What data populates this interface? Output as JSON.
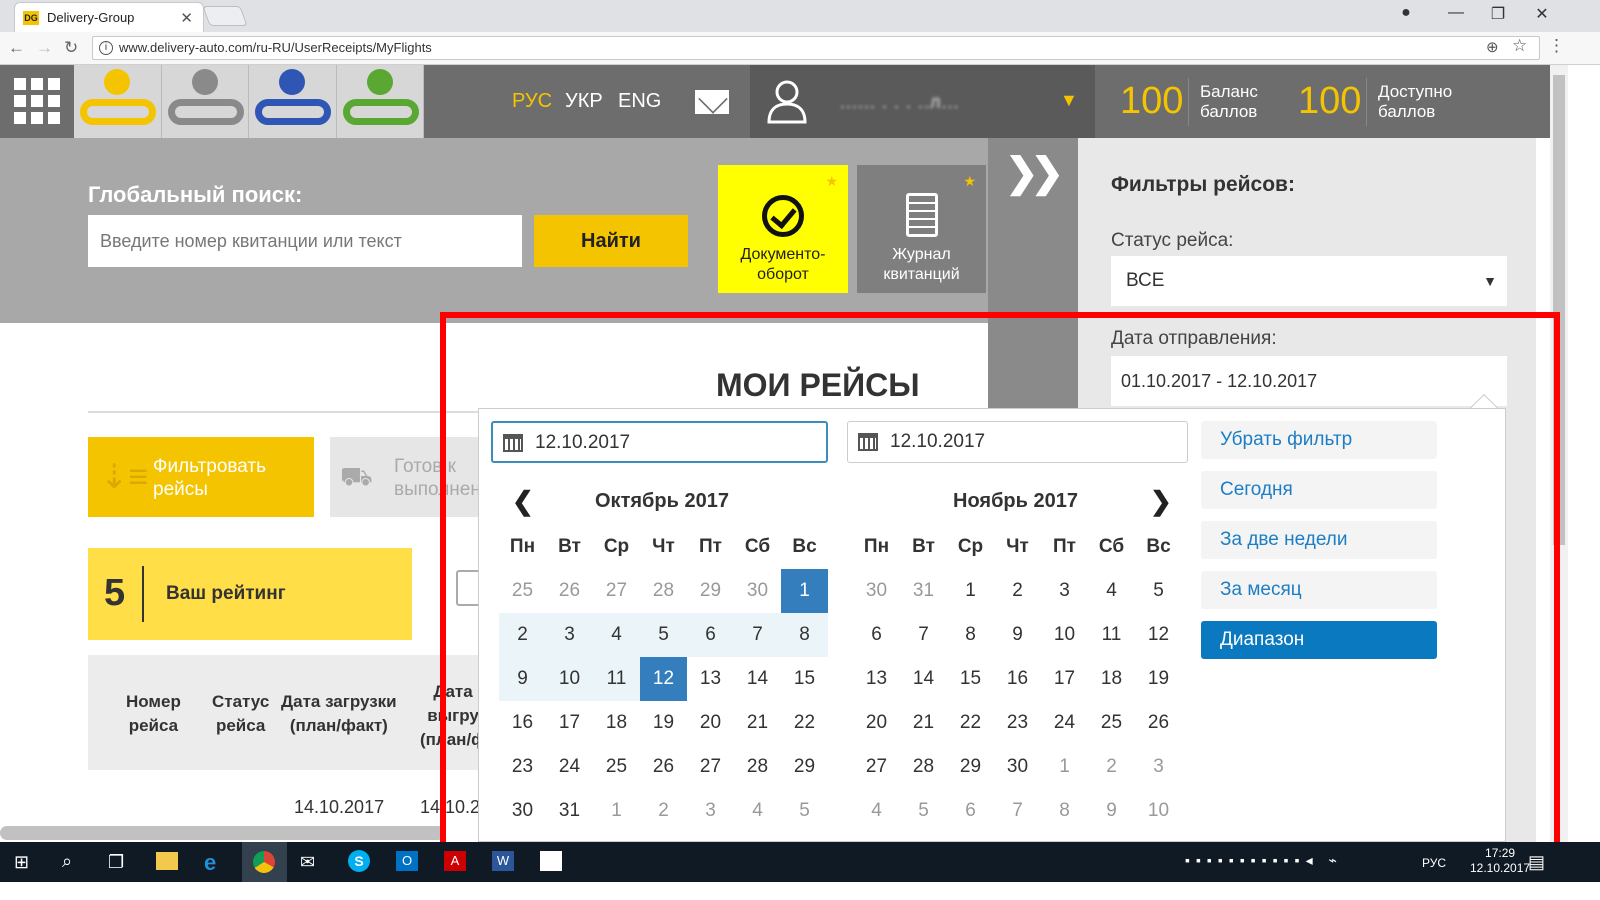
{
  "browser": {
    "tab_title": "Delivery-Group",
    "favicon_text": "DG",
    "url": "www.delivery-auto.com/ru-RU/UserReceipts/MyFlights"
  },
  "header": {
    "languages": [
      "РУС",
      "УКР",
      "ENG"
    ],
    "user_name": "...... . . . ..л...",
    "balance_value": "100",
    "balance_label_1": "Баланс",
    "balance_label_2": "баллов",
    "available_value": "100",
    "available_label_1": "Доступно",
    "available_label_2": "баллов",
    "logo_colors": [
      "#f5c400",
      "#8a8a8a",
      "#2f55b5",
      "#5aa832"
    ]
  },
  "search": {
    "label": "Глобальный поиск:",
    "placeholder": "Введите номер квитанции или текст",
    "button": "Найти"
  },
  "tiles": {
    "documents_line1": "Документо-",
    "documents_line2": "оборот",
    "journal_line1": "Журнал",
    "journal_line2": "квитанций"
  },
  "filters": {
    "title": "Фильтры рейсов:",
    "status_label": "Статус рейса:",
    "status_value": "ВСЕ",
    "date_label": "Дата отправления:",
    "date_value": "01.10.2017 - 12.10.2017"
  },
  "main": {
    "title": "МОИ РЕЙСЫ",
    "filter_button_line1": "Фильтровать",
    "filter_button_line2": "рейсы",
    "ready_button_line1": "Готов к",
    "ready_button_line2": "выполнен",
    "rating_value": "5",
    "rating_label": "Ваш рейтинг",
    "columns": [
      [
        "Номер",
        "рейса"
      ],
      [
        "Статус",
        "рейса"
      ],
      [
        "Дата загрузки",
        "(план/факт)"
      ],
      [
        "Дата",
        "выгру",
        "(план/ф"
      ]
    ],
    "row1_load_date": "14.10.2017",
    "row1_unload_date": "14.10.2"
  },
  "datepicker": {
    "start_date": "12.10.2017",
    "end_date": "12.10.2017",
    "options": [
      "Убрать фильтр",
      "Сегодня",
      "За две недели",
      "За месяц",
      "Диапазон"
    ],
    "active_option": "Диапазон",
    "weekdays": [
      "Пн",
      "Вт",
      "Ср",
      "Чт",
      "Пт",
      "Сб",
      "Вс"
    ],
    "left_month": {
      "title": "Октябрь 2017",
      "days": [
        [
          "25",
          "26",
          "27",
          "28",
          "29",
          "30",
          "1"
        ],
        [
          "2",
          "3",
          "4",
          "5",
          "6",
          "7",
          "8"
        ],
        [
          "9",
          "10",
          "11",
          "12",
          "13",
          "14",
          "15"
        ],
        [
          "16",
          "17",
          "18",
          "19",
          "20",
          "21",
          "22"
        ],
        [
          "23",
          "24",
          "25",
          "26",
          "27",
          "28",
          "29"
        ],
        [
          "30",
          "31",
          "1",
          "2",
          "3",
          "4",
          "5"
        ]
      ],
      "off": [
        [
          0,
          0
        ],
        [
          0,
          1
        ],
        [
          0,
          2
        ],
        [
          0,
          3
        ],
        [
          0,
          4
        ],
        [
          0,
          5
        ],
        [
          5,
          2
        ],
        [
          5,
          3
        ],
        [
          5,
          4
        ],
        [
          5,
          5
        ],
        [
          5,
          6
        ]
      ],
      "selected": [
        [
          0,
          6
        ],
        [
          2,
          3
        ]
      ],
      "in_range": [
        [
          1,
          0
        ],
        [
          1,
          1
        ],
        [
          1,
          2
        ],
        [
          1,
          3
        ],
        [
          1,
          4
        ],
        [
          1,
          5
        ],
        [
          1,
          6
        ],
        [
          2,
          0
        ],
        [
          2,
          1
        ],
        [
          2,
          2
        ]
      ]
    },
    "right_month": {
      "title": "Ноябрь 2017",
      "days": [
        [
          "30",
          "31",
          "1",
          "2",
          "3",
          "4",
          "5"
        ],
        [
          "6",
          "7",
          "8",
          "9",
          "10",
          "11",
          "12"
        ],
        [
          "13",
          "14",
          "15",
          "16",
          "17",
          "18",
          "19"
        ],
        [
          "20",
          "21",
          "22",
          "23",
          "24",
          "25",
          "26"
        ],
        [
          "27",
          "28",
          "29",
          "30",
          "1",
          "2",
          "3"
        ],
        [
          "4",
          "5",
          "6",
          "7",
          "8",
          "9",
          "10"
        ]
      ],
      "off": [
        [
          0,
          0
        ],
        [
          0,
          1
        ],
        [
          4,
          4
        ],
        [
          4,
          5
        ],
        [
          4,
          6
        ],
        [
          5,
          0
        ],
        [
          5,
          1
        ],
        [
          5,
          2
        ],
        [
          5,
          3
        ],
        [
          5,
          4
        ],
        [
          5,
          5
        ],
        [
          5,
          6
        ]
      ],
      "selected": [],
      "in_range": []
    }
  },
  "taskbar": {
    "lang": "РУС",
    "time": "17:29",
    "date": "12.10.2017"
  },
  "colors": {
    "accent_yellow": "#f5c400",
    "highlight_red": "#ff0000",
    "picker_blue": "#357ebd"
  }
}
